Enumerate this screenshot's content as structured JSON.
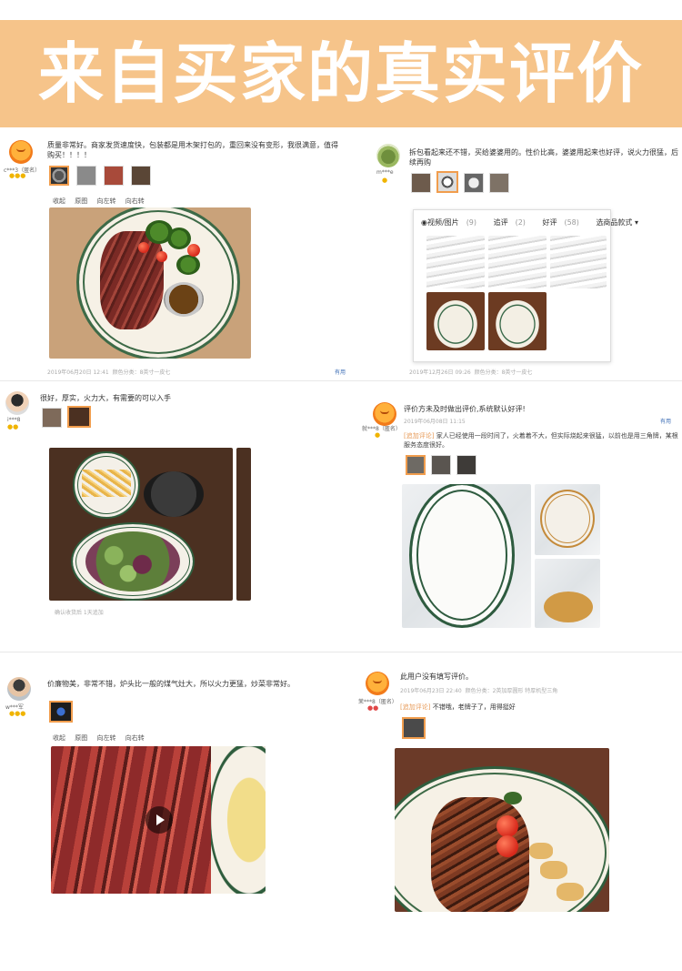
{
  "banner": {
    "title": "来自买家的真实评价"
  },
  "reviews": [
    {
      "user": "c***3（匿名）",
      "text": "质量非常好。商家发货速度快，包装都是用木架打包的，重回来没有变形，我很满意，值得购买！！！！",
      "tools": [
        "收起",
        "原图",
        "向左转",
        "向右转"
      ],
      "date": "2019年06月20日 12:41",
      "extra": "颜色分类：8英寸一皮七",
      "useful": "有用"
    },
    {
      "user": "m***e",
      "text": "拆包看起来还不错，买给婆婆用的。性价比高，婆婆用起来也好评，说火力很猛，后续再购",
      "date": "2019年12月26日 09:26",
      "extra": "颜色分类：8英寸一皮七"
    },
    {
      "user": "i***8",
      "text": "很好，厚实，火力大，有需要的可以入手",
      "date": "确认收货后 1天追加"
    },
    {
      "user": "就***8（匿名）",
      "text": "评价方未及时做出评价,系统默认好评!",
      "date": "2019年06月08日 11:15",
      "useful": "有用",
      "append_label": "[追加评论]",
      "append_text": "家人已经使用一段时间了，火着着不大，但实际烧起来很猛，以前也是用三角牌，某根服务态度很好。"
    },
    {
      "user": "w***军",
      "text": "价廉物美，非常不错，炉头比一般的煤气灶大，所以火力更猛，炒菜非常好。",
      "tools": [
        "收起",
        "原图",
        "向左转",
        "向右转"
      ]
    },
    {
      "user": "茉***8（匿名）",
      "text": "此用户没有填写评价。",
      "date": "2019年06月23日 22:40",
      "extra": "颜色分类：2英加厚圆形 特厚机型三角 ",
      "append_label": "[追加评论]",
      "append_text": "不错哦，老牌子了，用得挺好"
    }
  ],
  "popup": {
    "tabs": [
      {
        "label": "◉视频/图片",
        "count": "(9)"
      },
      {
        "label": "追评",
        "count": "(2)"
      },
      {
        "label": "好评",
        "count": "(58)"
      },
      {
        "label": "选商品款式 ▾",
        "count": ""
      }
    ]
  },
  "colors": {
    "banner": "#f6c48a",
    "accent": "#f19d4d",
    "plate_rim": "#2e5b3f"
  }
}
